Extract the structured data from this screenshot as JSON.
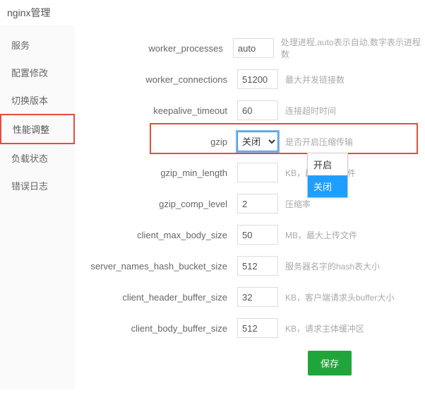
{
  "header": {
    "title": "nginx管理"
  },
  "sidebar": {
    "items": [
      {
        "label": "服务"
      },
      {
        "label": "配置修改"
      },
      {
        "label": "切换版本"
      },
      {
        "label": "性能调整"
      },
      {
        "label": "负载状态"
      },
      {
        "label": "错误日志"
      }
    ]
  },
  "form": {
    "rows": [
      {
        "label": "worker_processes",
        "value": "auto",
        "desc": "处理进程,auto表示自动,数字表示进程数"
      },
      {
        "label": "worker_connections",
        "value": "51200",
        "desc": "最大并发链接数"
      },
      {
        "label": "keepalive_timeout",
        "value": "60",
        "desc": "连接超时时间"
      },
      {
        "label": "gzip",
        "value": "关闭",
        "desc": "是否开启压缩传输"
      },
      {
        "label": "gzip_min_length",
        "value": "",
        "desc": "KB，最小压缩文件"
      },
      {
        "label": "gzip_comp_level",
        "value": "2",
        "desc": "压缩率"
      },
      {
        "label": "client_max_body_size",
        "value": "50",
        "desc": "MB，最大上传文件"
      },
      {
        "label": "server_names_hash_bucket_size",
        "value": "512",
        "desc": "服务器名字的hash表大小"
      },
      {
        "label": "client_header_buffer_size",
        "value": "32",
        "desc": "KB，客户端请求头buffer大小"
      },
      {
        "label": "client_body_buffer_size",
        "value": "512",
        "desc": "KB，请求主体缓冲区"
      }
    ],
    "gzip_options": [
      {
        "label": "开启"
      },
      {
        "label": "关闭"
      }
    ],
    "save_label": "保存"
  }
}
